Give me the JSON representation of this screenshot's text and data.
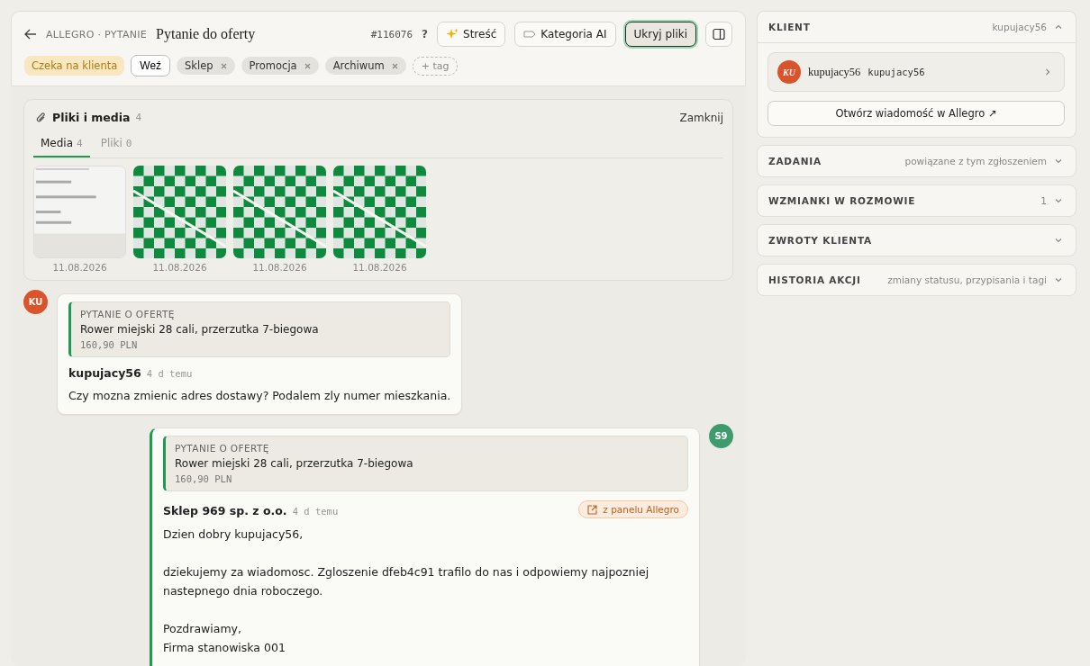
{
  "header": {
    "breadcrumb": "ALLEGRO · PYTANIE",
    "title": "Pytanie do oferty",
    "ticket": "#116076",
    "help": "?",
    "actions": [
      {
        "kind": "sparkle",
        "label": "Streść",
        "selected": false
      },
      {
        "kind": "tag",
        "label": "Kategoria AI",
        "selected": false
      },
      {
        "kind": "plain",
        "label": "Ukryj pliki",
        "selected": true
      }
    ],
    "status": "Czeka na klienta",
    "take": "Weź",
    "tags": [
      "Sklep",
      "Promocja",
      "Archiwum"
    ],
    "add_tag": "+ tag"
  },
  "files": {
    "title": "Pliki i media",
    "count": "4",
    "close": "Zamknij",
    "tabs": [
      {
        "label": "Media",
        "count": "4",
        "selected": true
      },
      {
        "label": "Pliki",
        "count": "0",
        "selected": false
      }
    ],
    "media": [
      {
        "kind": "picture",
        "date": "11.08.2026"
      },
      {
        "kind": "checker",
        "date": "11.08.2026"
      },
      {
        "kind": "checker",
        "date": "11.08.2026"
      },
      {
        "kind": "checker",
        "date": "11.08.2026"
      }
    ]
  },
  "messages": [
    {
      "kind": "customer",
      "avatar": "KU",
      "color": "#d9532b",
      "quote_label": "PYTANIE O OFERTĘ",
      "quote_title": "Rower miejski 28 cali, przerzutka 7-biegowa",
      "quote_price": "160,90 PLN",
      "author": "kupujacy56",
      "time": "4 d temu",
      "paragraphs": [
        "Czy mozna zmienic adres dostawy? Podalem zly numer mieszkania."
      ]
    },
    {
      "kind": "shop",
      "avatar": "S9",
      "color": "#3f9a6e",
      "quote_label": "PYTANIE O OFERTĘ",
      "quote_title": "Rower miejski 28 cali, przerzutka 7-biegowa",
      "quote_price": "160,90 PLN",
      "author": "Sklep 969 sp. z o.o.",
      "time": "4 d temu",
      "source": "z panelu Allegro",
      "paragraphs": [
        "Dzien dobry kupujacy56,",
        "dziekujemy za wiadomosc. Zgloszenie dfeb4c91 trafilo do nas i odpowiemy najpozniej nastepnego dnia roboczego.",
        "Pozdrawiamy,\nFirma stanowiska 001"
      ]
    }
  ],
  "sidebar": {
    "client": {
      "title": "KLIENT",
      "summary": "kupujacy56",
      "expanded": true,
      "avatar": "KU",
      "name": "kupujacy56",
      "login": "kupujacy56",
      "open_button": "Otwórz wiadomość w Allegro ↗"
    },
    "sections": [
      {
        "title": "ZADANIA",
        "summary": "powiązane z tym zgłoszeniem",
        "expanded": false
      },
      {
        "title": "WZMIANKI W ROZMOWIE",
        "summary": "1",
        "expanded": false
      },
      {
        "title": "ZWROTY KLIENTA",
        "expanded": false
      },
      {
        "title": "HISTORIA AKCJI",
        "summary": "zmiany statusu, przypisania i tagi",
        "expanded": false
      }
    ]
  }
}
